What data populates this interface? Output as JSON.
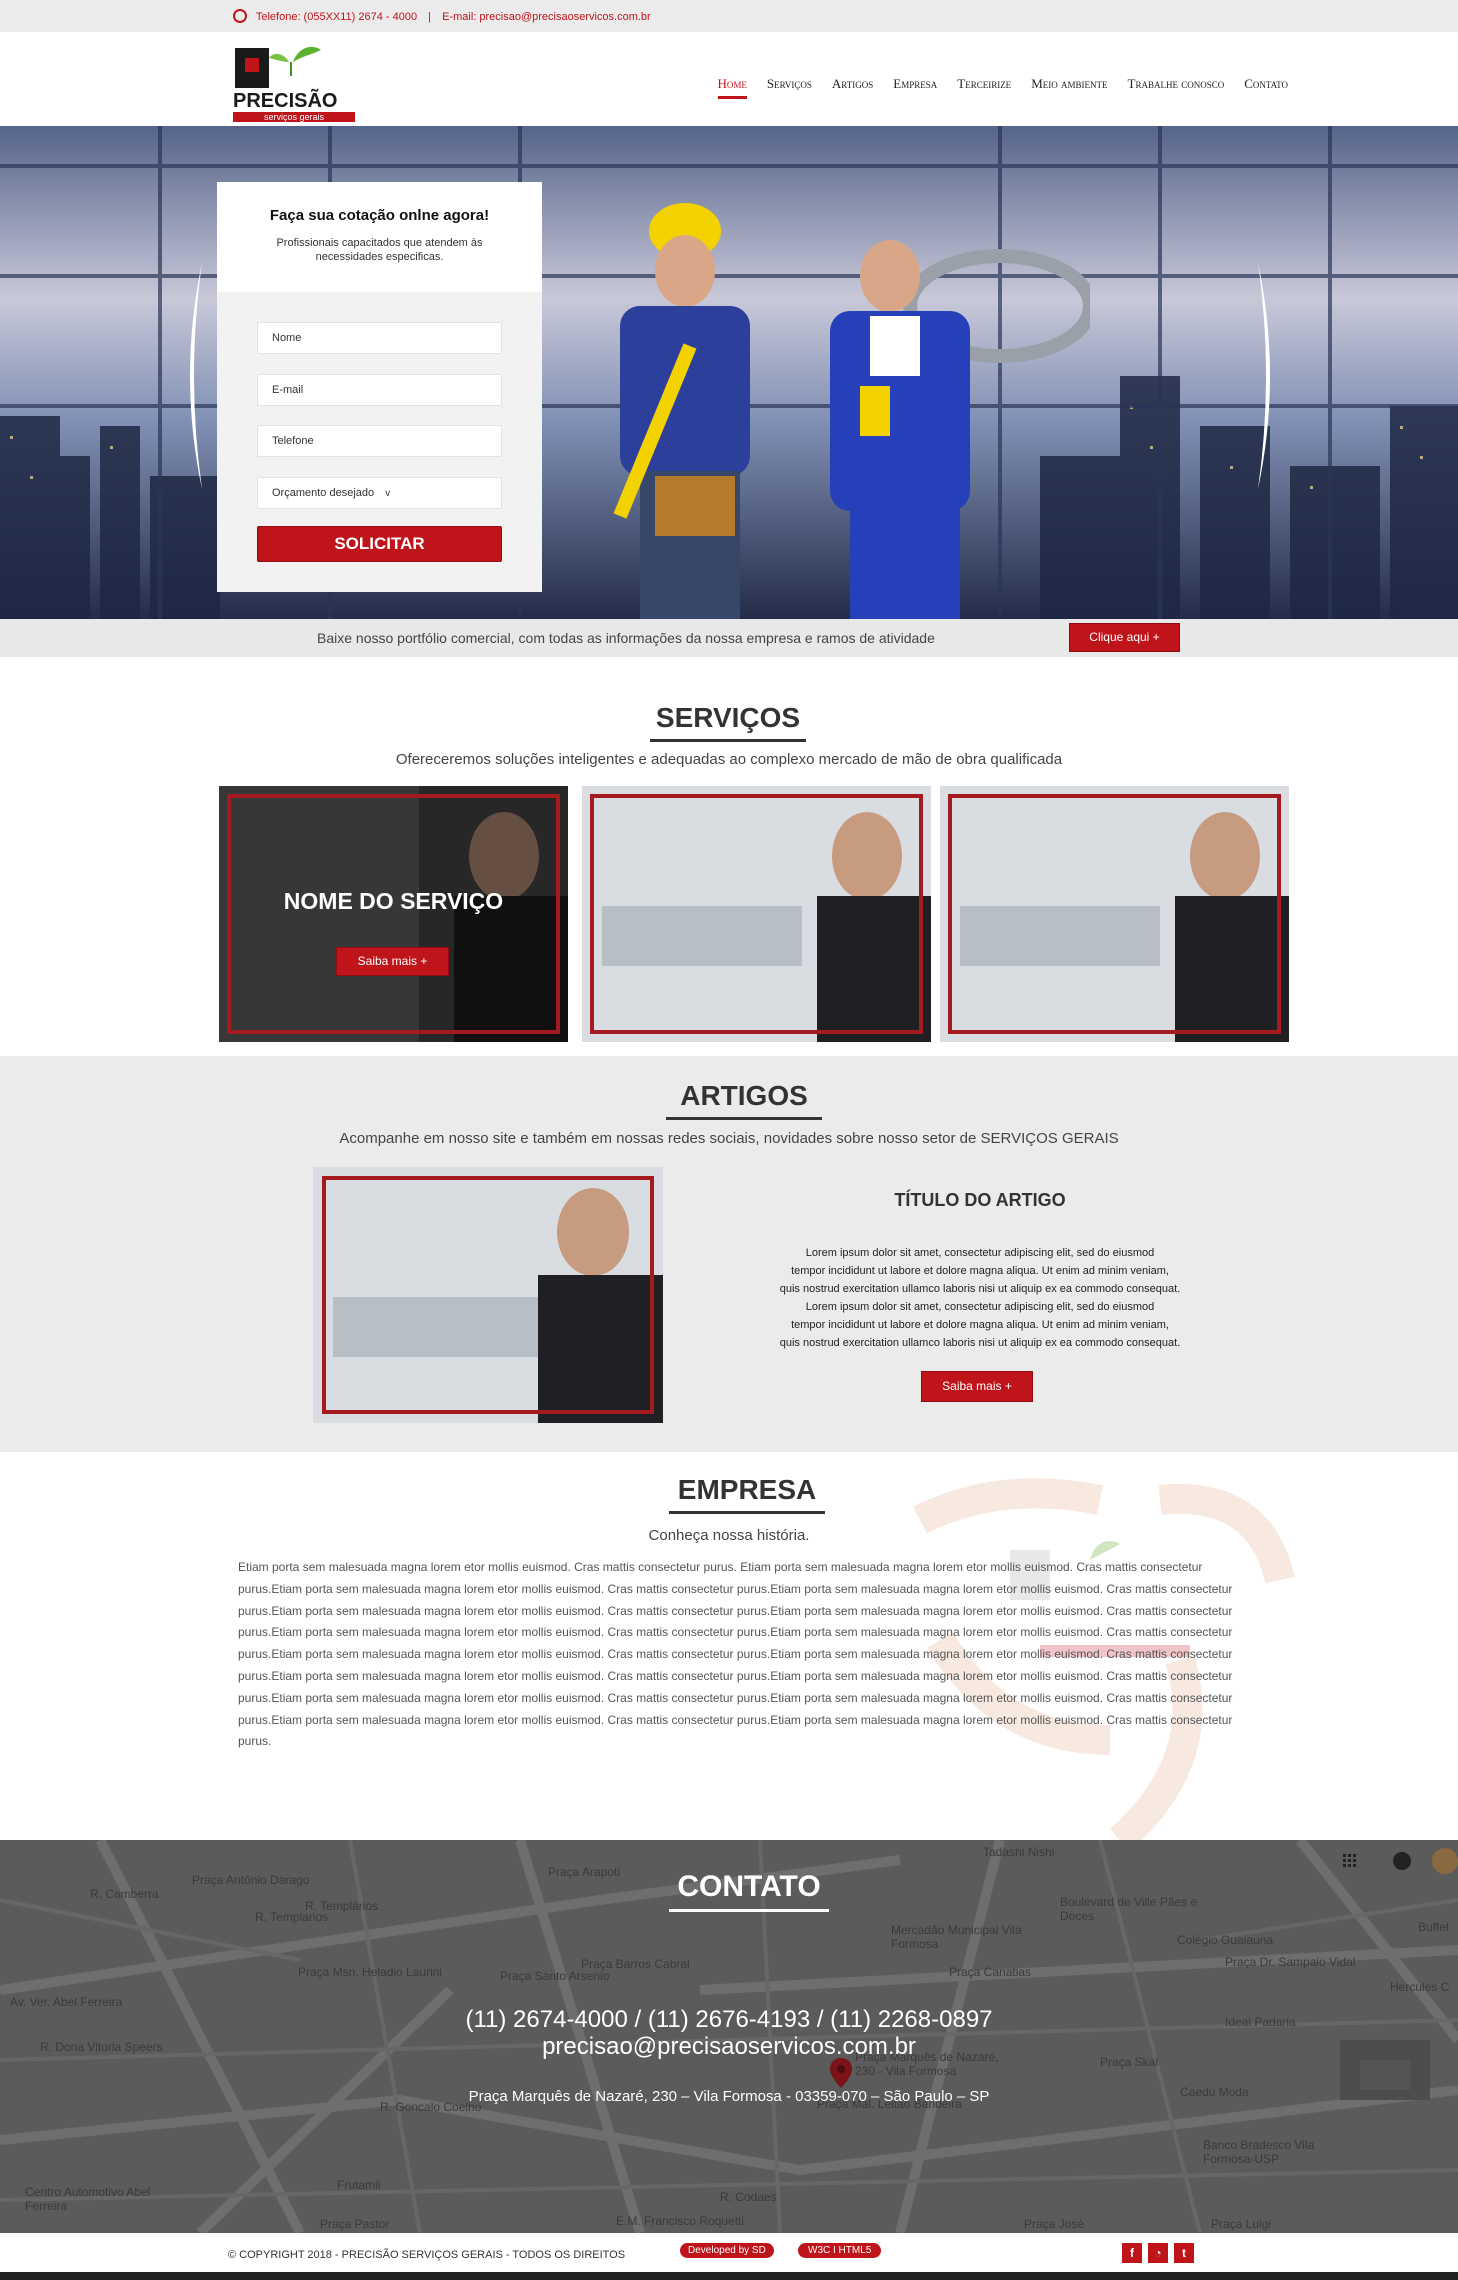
{
  "topbar": {
    "phone": "Telefone: (055XX11) 2674 - 4000",
    "sep": "|",
    "email": "E-mail: precisao@precisaoservicos.com.br"
  },
  "brand": {
    "letter": "P",
    "name": "PRECISÃO",
    "tagline": "serviços gerais",
    "accent": "#c0141b"
  },
  "nav": [
    {
      "label": "Home",
      "active": true
    },
    {
      "label": "Serviços"
    },
    {
      "label": "Artigos"
    },
    {
      "label": "Empresa"
    },
    {
      "label": "Terceirize"
    },
    {
      "label": "Meio ambiente"
    },
    {
      "label": "Trabalhe conosco"
    },
    {
      "label": "Contato"
    }
  ],
  "hero": {
    "form": {
      "title": "Faça sua cotação onlne agora!",
      "subtitle": "Profissionais capacitados que atendem às necessidades especificas.",
      "name_placeholder": "Nome",
      "email_placeholder": "E-mail",
      "phone_placeholder": "Telefone",
      "budget_select": "Orçamento desejado",
      "budget_arrow": "v",
      "submit": "SOLICITAR"
    }
  },
  "portfolio": {
    "text": "Baixe nosso portfólio comercial, com todas as informações da nossa empresa e ramos de atividade",
    "button": "Clique aqui +"
  },
  "servicos": {
    "title": "SERVIÇOS",
    "subtitle": "Ofereceremos soluções inteligentes e adequadas ao complexo mercado de mão de obra qualificada",
    "card_title": "NOME DO SERVIÇO",
    "card_button": "Saiba mais +"
  },
  "artigos": {
    "title": "ARTIGOS",
    "subtitle": "Acompanhe em nosso site e também em nossas redes sociais, novidades sobre nosso setor de SERVIÇOS GERAIS",
    "article_title": "TÍTULO DO ARTIGO",
    "body": [
      "Lorem ipsum dolor sit amet, consectetur adipiscing elit, sed do eiusmod",
      "tempor incididunt ut labore et dolore magna aliqua. Ut enim ad minim veniam,",
      "quis nostrud exercitation ullamco laboris nisi ut aliquip ex ea commodo consequat.",
      "Lorem ipsum dolor sit amet, consectetur adipiscing elit, sed do eiusmod",
      "tempor incididunt ut labore et dolore magna aliqua. Ut enim ad minim veniam,",
      "quis nostrud exercitation ullamco laboris nisi ut aliquip ex ea commodo consequat."
    ],
    "button": "Saiba mais +"
  },
  "empresa": {
    "title": "EMPRESA",
    "subtitle": "Conheça nossa história.",
    "body": "Etiam porta sem malesuada magna lorem etor mollis euismod. Cras mattis consectetur purus. Etiam porta sem malesuada magna lorem etor mollis euismod. Cras mattis consectetur purus.Etiam porta sem malesuada magna lorem etor mollis euismod. Cras mattis consectetur purus.Etiam porta sem malesuada magna lorem etor mollis euismod. Cras mattis consectetur purus.Etiam porta sem malesuada magna lorem etor mollis euismod. Cras mattis consectetur purus.Etiam porta sem malesuada magna lorem etor mollis euismod. Cras mattis consectetur purus.Etiam porta sem malesuada magna lorem etor mollis euismod. Cras mattis consectetur purus.Etiam porta sem malesuada magna lorem etor mollis euismod. Cras mattis consectetur purus.Etiam porta sem malesuada magna lorem etor mollis euismod. Cras mattis consectetur purus.Etiam porta sem malesuada magna lorem etor mollis euismod. Cras mattis consectetur purus.Etiam porta sem malesuada magna lorem etor mollis euismod. Cras mattis consectetur purus.Etiam porta sem malesuada magna lorem etor mollis euismod. Cras mattis consectetur purus.Etiam porta sem malesuada magna lorem etor mollis euismod. Cras mattis consectetur purus.Etiam porta sem malesuada magna lorem etor mollis euismod. Cras mattis consectetur purus.Etiam porta sem malesuada magna lorem etor mollis euismod. Cras mattis consectetur purus.Etiam porta sem malesuada magna lorem etor mollis euismod. Cras mattis consectetur purus."
  },
  "contato": {
    "title": "CONTATO",
    "phones": "(11) 2674-4000 / (11) 2676-4193 / (11) 2268-0897",
    "email": "precisao@precisaoservicos.com.br",
    "address": "Praça Marquês de Nazaré, 230 – Vila Formosa - 03359-070 – São Paulo – SP",
    "map_labels": [
      "Praça Antônio Darago",
      "R. Camberra",
      "R. Templários",
      "Praça Arapoti",
      "Tadashi Nishi",
      "Boulevard de Ville Pães e Doces",
      "Colégio Guaiauna",
      "Buffet",
      "Mercadão Municipal Vila Formosa",
      "Praça Barros Cabral",
      "Praça Canatias",
      "Praça Dr. Sampaio Vidal",
      "Hercules C",
      "Praça Msn. Heladio Laurini",
      "Praça Santo Arsenio",
      "Ideal Padaria",
      "Praça Marquês de Nazaré, 230 - Vila Formosa",
      "Praça Skal",
      "Caedu Moda",
      "Av. Ver. Abel Ferreira",
      "Banco Bradesco Vila Formosa-USP",
      "Praça Mal. Leitao Bandeira",
      "Frutamil",
      "Centro Automotivo Abel Ferreira",
      "Praça Pastor",
      "E.M. Francisco Roquetti",
      "Praça José",
      "Praça Luigi",
      "R. Templarios",
      "R. Dona Vitoria Speers",
      "R. Goncalo Coelho",
      "R. Codaes"
    ]
  },
  "footer": {
    "copyright": "© COPYRIGHT 2018 - PRECISÃO SERVIÇOS GERAIS - TODOS OS DIREITOS",
    "dev": "Developed by SD",
    "w3c": "W3C  I  HTML5",
    "social": [
      {
        "icon": "facebook-icon",
        "glyph": "f"
      },
      {
        "icon": "rss-icon",
        "glyph": "◔"
      },
      {
        "icon": "twitter-icon",
        "glyph": "t"
      }
    ]
  }
}
